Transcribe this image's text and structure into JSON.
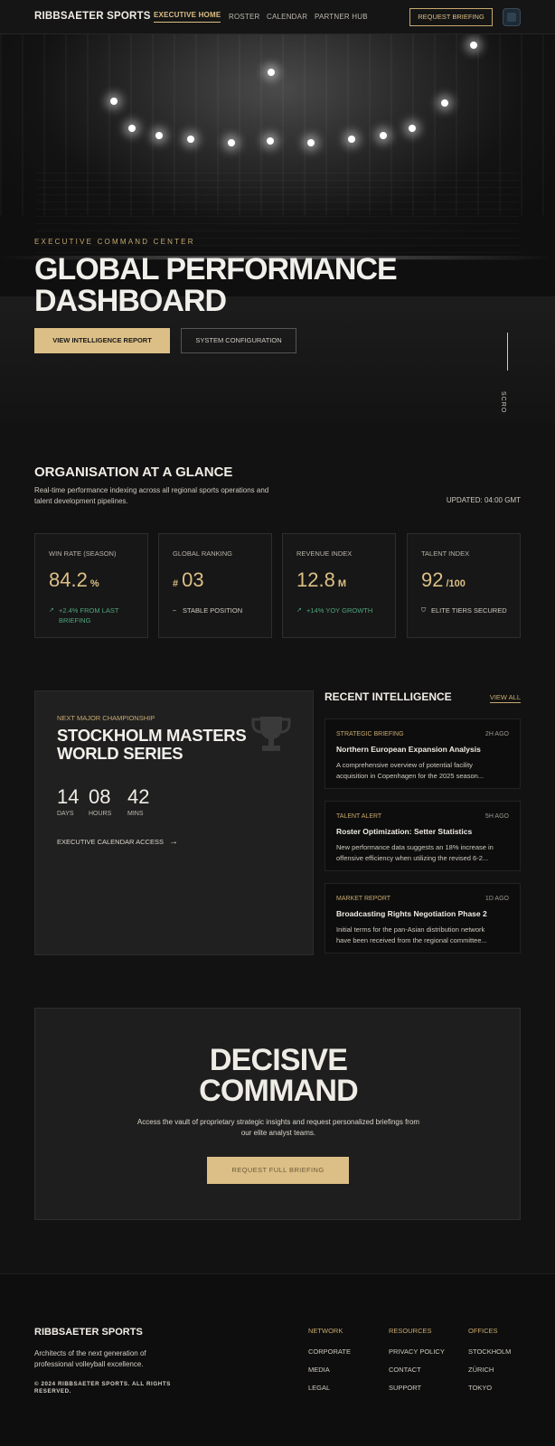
{
  "nav": {
    "brand": "RIBBSAETER SPORTS",
    "links": [
      "EXECUTIVE HOME",
      "ROSTER",
      "CALENDAR",
      "PARTNER HUB"
    ],
    "request_label": "REQUEST BRIEFING",
    "avatar_icon": "user-avatar-icon"
  },
  "hero": {
    "kicker": "EXECUTIVE COMMAND CENTER",
    "title": "GLOBAL PERFORMANCE DASHBOARD",
    "primary_button": "VIEW INTELLIGENCE REPORT",
    "secondary_button": "SYSTEM CONFIGURATION",
    "scroll_label": "SCRO"
  },
  "org": {
    "title": "ORGANISATION AT A GLANCE",
    "description": "Real-time performance indexing across all regional sports operations and talent development pipelines.",
    "updated": "UPDATED: 04:00 GMT",
    "stats": [
      {
        "label": "WIN RATE (SEASON)",
        "prefix": "",
        "value": "84.2",
        "unit": "%",
        "note": "+2.4% FROM LAST BRIEFING",
        "note_icon": "trend-up-icon",
        "note_color": "#4fa57c"
      },
      {
        "label": "GLOBAL RANKING",
        "prefix": "#",
        "value": "03",
        "unit": "",
        "note": "STABLE POSITION",
        "note_icon": "dash-icon",
        "note_color": "#cfcac0"
      },
      {
        "label": "REVENUE INDEX",
        "prefix": "",
        "value": "12.8",
        "unit": "M",
        "note": "+14% YOY GROWTH",
        "note_icon": "trend-up-icon",
        "note_color": "#4fa57c"
      },
      {
        "label": "TALENT INDEX",
        "prefix": "",
        "value": "92",
        "unit": "/100",
        "note": "ELITE TIERS SECURED",
        "note_icon": "shield-icon",
        "note_color": "#cfcac0"
      }
    ]
  },
  "championship": {
    "kicker": "NEXT MAJOR CHAMPIONSHIP",
    "title": "STOCKHOLM MASTERS WORLD SERIES",
    "countdown": [
      {
        "value": "14",
        "label": "DAYS"
      },
      {
        "value": "08",
        "label": "HOURS"
      },
      {
        "value": "42",
        "label": "MINS"
      }
    ],
    "link": "EXECUTIVE CALENDAR ACCESS",
    "icon": "trophy-icon"
  },
  "intel": {
    "title": "RECENT INTELLIGENCE",
    "view_all": "VIEW ALL",
    "cards": [
      {
        "category": "STRATEGIC BRIEFING",
        "ago": "2H AGO",
        "title": "Northern European Expansion Analysis",
        "line1": "A comprehensive overview of potential facility",
        "line2": "acquisition in Copenhagen for the 2025 season..."
      },
      {
        "category": "TALENT ALERT",
        "ago": "5H AGO",
        "title": "Roster Optimization: Setter Statistics",
        "line1": "New performance data suggests an 18% increase in",
        "line2": "offensive efficiency when utilizing the revised 6-2..."
      },
      {
        "category": "MARKET REPORT",
        "ago": "1D AGO",
        "title": "Broadcasting Rights Negotiation Phase 2",
        "line1": "Initial terms for the pan-Asian distribution network",
        "line2": "have been received from the regional committee..."
      }
    ]
  },
  "decisive": {
    "title_line1": "DECISIVE",
    "title_line2": "COMMAND",
    "description": "Access the vault of proprietary strategic insights and request personalized briefings from our elite analyst teams.",
    "cta": "REQUEST FULL BRIEFING"
  },
  "footer": {
    "brand": "RIBBSAETER SPORTS",
    "tagline": "Architects of the next generation of professional volleyball excellence.",
    "copyright": "© 2024 RIBBSAETER SPORTS. ALL RIGHTS RESERVED.",
    "columns": [
      {
        "heading": "NETWORK",
        "items": [
          "CORPORATE",
          "MEDIA",
          "LEGAL"
        ]
      },
      {
        "heading": "RESOURCES",
        "items": [
          "PRIVACY POLICY",
          "CONTACT",
          "SUPPORT"
        ]
      },
      {
        "heading": "OFFICES",
        "items": [
          "STOCKHOLM",
          "ZÜRICH",
          "TOKYO"
        ]
      }
    ]
  },
  "colors": {
    "accent_gold": "#dcbf86",
    "positive_green": "#4fa57c",
    "background": "#121212"
  }
}
